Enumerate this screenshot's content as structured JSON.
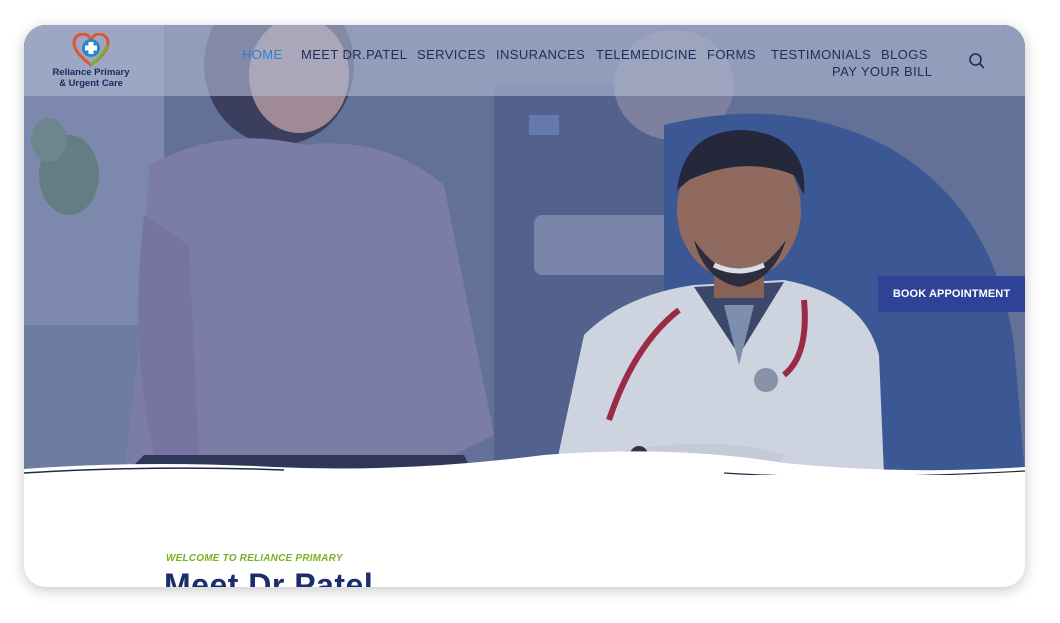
{
  "brand": {
    "name_line1": "Reliance Primary",
    "name_line2": "& Urgent Care"
  },
  "nav": {
    "items": [
      {
        "label": "HOME",
        "active": true
      },
      {
        "label": "MEET DR.PATEL",
        "active": false
      },
      {
        "label": "SERVICES",
        "active": false
      },
      {
        "label": "INSURANCES",
        "active": false
      },
      {
        "label": "TELEMEDICINE",
        "active": false
      },
      {
        "label": "FORMS",
        "active": false
      },
      {
        "label": "TESTIMONIALS",
        "active": false
      },
      {
        "label": "BLOGS",
        "active": false
      },
      {
        "label": "PAY YOUR BILL",
        "active": false
      }
    ],
    "search_icon": "search-icon"
  },
  "hero": {
    "cta_label": "BOOK APPOINTMENT"
  },
  "intro": {
    "eyebrow": "WELCOME TO RELIANCE PRIMARY",
    "heading": "Meet Dr Patel"
  },
  "colors": {
    "nav_text": "#1e2d61",
    "nav_active": "#2d7fd1",
    "cta_bg": "#2f4297",
    "eyebrow": "#7ab024",
    "heading": "#1b2d6e"
  }
}
